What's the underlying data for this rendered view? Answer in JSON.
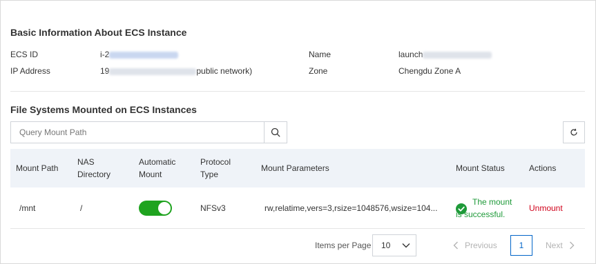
{
  "basic": {
    "title": "Basic Information About ECS Instance",
    "ecs_id_label": "ECS ID",
    "ecs_id_value": "i-2",
    "ip_label": "IP Address",
    "ip_value_prefix": "19",
    "ip_value_suffix": "public network)",
    "name_label": "Name",
    "name_value": "launch",
    "zone_label": "Zone",
    "zone_value": "Chengdu Zone A"
  },
  "mounts": {
    "title": "File Systems Mounted on ECS Instances",
    "search_placeholder": "Query Mount Path",
    "search_icon": "search-icon",
    "refresh_icon": "refresh-icon"
  },
  "table": {
    "headers": {
      "mount_path": "Mount Path",
      "nas_dir_1": "NAS",
      "nas_dir_2": "Directory",
      "auto_1": "Automatic",
      "auto_2": "Mount",
      "proto_1": "Protocol",
      "proto_2": "Type",
      "params": "Mount Parameters",
      "status": "Mount Status",
      "actions": "Actions"
    },
    "rows": [
      {
        "mount_path": "/mnt",
        "nas_directory": "/",
        "automatic_mount": true,
        "protocol": "NFSv3",
        "params": "rw,relatime,vers=3,rsize=1048576,wsize=104...",
        "status": "The mount is successful.",
        "action": "Unmount"
      }
    ]
  },
  "pagination": {
    "items_per_page_label": "Items per Page",
    "page_size": "10",
    "previous": "Previous",
    "current_page": "1",
    "next": "Next"
  },
  "colors": {
    "success": "#1e9a39",
    "danger": "#d0021b",
    "primary": "#0064c8",
    "toggle_on": "#1fa31f",
    "header_bg": "#eff3f8"
  }
}
